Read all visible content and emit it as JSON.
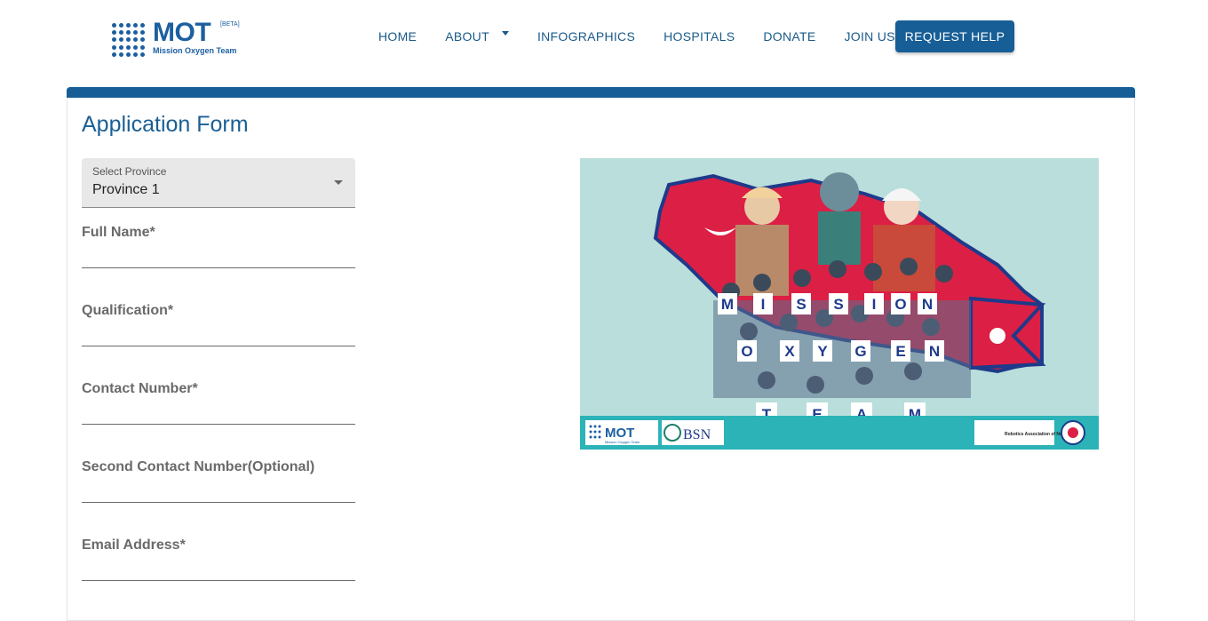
{
  "brand": {
    "name": "MOT",
    "beta": "[BETA]",
    "subtitle": "Mission Oxygen Team",
    "color": "#1c5fa0"
  },
  "nav": {
    "items": [
      {
        "label": "HOME"
      },
      {
        "label": "ABOUT",
        "has_dropdown": true
      },
      {
        "label": "INFOGRAPHICS"
      },
      {
        "label": "HOSPITALS"
      },
      {
        "label": "DONATE"
      },
      {
        "label": "JOIN US"
      }
    ],
    "request_help": "REQUEST HELP"
  },
  "form": {
    "title": "Application Form",
    "province": {
      "label": "Select Province",
      "value": "Province 1"
    },
    "fields": [
      {
        "label": "Full Name*",
        "value": ""
      },
      {
        "label": "Qualification*",
        "value": ""
      },
      {
        "label": "Contact Number*",
        "value": ""
      },
      {
        "label": "Second Contact Number(Optional)",
        "value": ""
      },
      {
        "label": "Email Address*",
        "value": ""
      }
    ]
  },
  "banner": {
    "letters_row1": [
      "M",
      "I",
      "S",
      "S",
      "I",
      "O",
      "N"
    ],
    "letters_row2": [
      "O",
      "X",
      "Y",
      "G",
      "E",
      "N"
    ],
    "letters_row3": [
      "T",
      "E",
      "A",
      "M"
    ],
    "footer_left": "MOT",
    "footer_left_sub": "Mission Oxygen Team",
    "footer_bsn": "BSN",
    "footer_robotics": "Robotics Association of Nepal",
    "colors": {
      "teal": "#2bb3b8",
      "flag_red": "#dc1f45",
      "flag_blue": "#1e3a8a"
    }
  },
  "colors": {
    "primary": "#175e96",
    "title": "#1a5f95"
  }
}
